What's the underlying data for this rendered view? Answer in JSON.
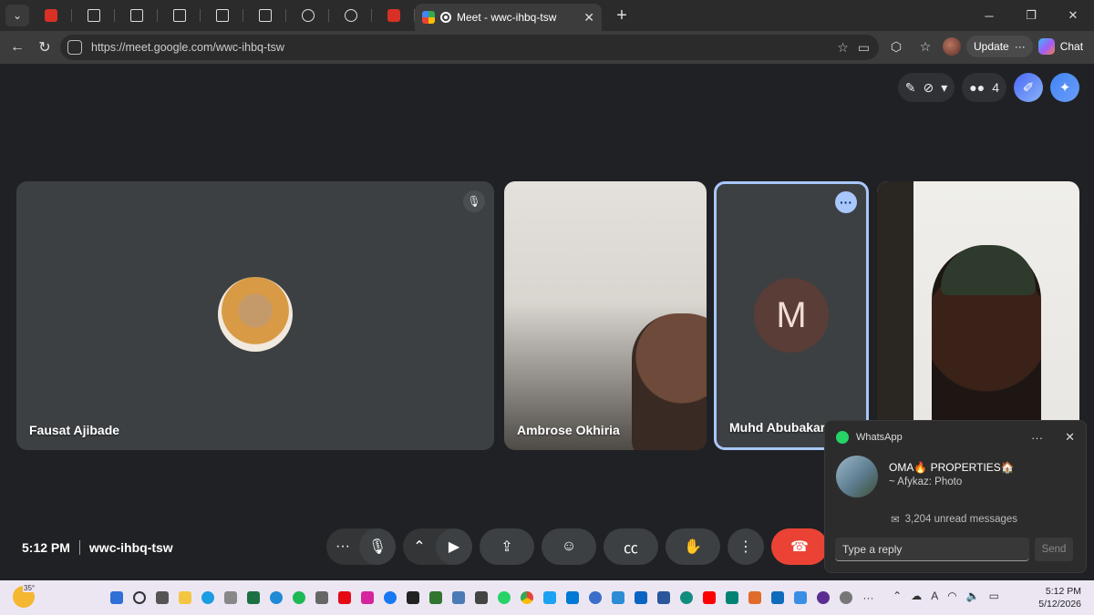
{
  "browser": {
    "active_tab_title": "Meet - wwc-ihbq-tsw",
    "url": "https://meet.google.com/wwc-ihbq-tsw",
    "update_label": "Update",
    "chat_label": "Chat"
  },
  "meet": {
    "participant_count": "4",
    "time": "5:12 PM",
    "meeting_code": "wwc-ihbq-tsw",
    "participants": [
      {
        "name": "Fausat Ajibade"
      },
      {
        "name": "Ambrose Okhiria"
      },
      {
        "name": "Muhd Abubakar",
        "initial": "M"
      },
      {
        "name": ""
      }
    ]
  },
  "notification": {
    "app": "WhatsApp",
    "title": "OMA🔥 PROPERTIES🏠",
    "subtitle": "~ Afykaz: Photo",
    "unread": "3,204 unread messages",
    "reply_placeholder": "Type a reply",
    "send_label": "Send"
  },
  "taskbar": {
    "temperature": "35°",
    "time": "5:12 PM",
    "date": "5/12/2026"
  },
  "colors": {
    "meet_bg": "#202124",
    "end_call": "#ea4335",
    "active_speaker": "#a8c7fa",
    "whatsapp": "#25d366"
  }
}
